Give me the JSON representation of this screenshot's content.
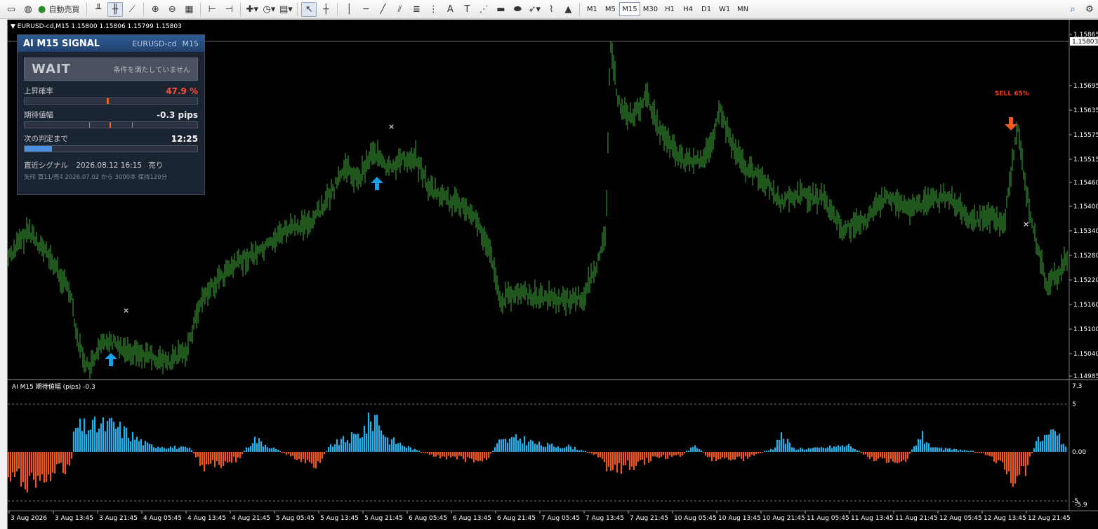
{
  "toolbar": {
    "auto_trade_label": "自動売買",
    "timeframes": [
      "M1",
      "M5",
      "M15",
      "M30",
      "H1",
      "H4",
      "D1",
      "W1",
      "MN"
    ],
    "active_timeframe": "M15"
  },
  "chart": {
    "header": "EURUSD-cd,M15  1.15800 1.15806 1.15799 1.15803",
    "current_price_label": "1.15803",
    "price_ticks": [
      "1.15865",
      "1.15803",
      "1.15695",
      "1.15635",
      "1.15575",
      "1.15515",
      "1.15460",
      "1.15400",
      "1.15340",
      "1.15280",
      "1.15220",
      "1.15160",
      "1.15100",
      "1.15040",
      "1.14985"
    ],
    "sell_label": "SELL 65%",
    "time_ticks": [
      "3 Aug 2026",
      "3 Aug 13:45",
      "3 Aug 21:45",
      "4 Aug 05:45",
      "4 Aug 13:45",
      "4 Aug 21:45",
      "5 Aug 05:45",
      "5 Aug 13:45",
      "5 Aug 21:45",
      "6 Aug 05:45",
      "6 Aug 13:45",
      "6 Aug 21:45",
      "7 Aug 05:45",
      "7 Aug 13:45",
      "7 Aug 21:45",
      "10 Aug 05:45",
      "10 Aug 13:45",
      "10 Aug 21:45",
      "11 Aug 05:45",
      "11 Aug 13:45",
      "11 Aug 21:45",
      "12 Aug 05:45",
      "12 Aug 13:45",
      "12 Aug 21:45"
    ],
    "colors": {
      "candle": "#3fae3a",
      "buy_arrow": "#1aa0e8",
      "sell_arrow": "#f25a1a",
      "hist_pos": "#1fb4f0",
      "hist_neg": "#f2561a"
    }
  },
  "indicator": {
    "header": "AI M15 期待値幅 (pips) -0.3",
    "scale_max": "7.3",
    "scale_levels": [
      "5",
      "0.00",
      "-5"
    ],
    "scale_min": "-5.9"
  },
  "panel": {
    "title": "AI M15 SIGNAL",
    "symbol": "EURUSD-cd",
    "timeframe": "M15",
    "status": "WAIT",
    "status_message": "条件を満たしていません",
    "up_prob_label": "上昇確率",
    "up_prob_value": "47.9 %",
    "up_prob_color": "#ff4a3a",
    "up_prob_fraction": 0.479,
    "expected_label": "期待値幅",
    "expected_value": "-0.3 pips",
    "next_label": "次の判定まで",
    "next_value": "12:25",
    "next_fraction": 0.16,
    "recent_label": "直近シグナル",
    "recent_value": "2026.08.12 16:15",
    "recent_side": "売り",
    "meta": "矢印 買11/売4  2026.07.02 から 3000本  保持120分"
  }
}
